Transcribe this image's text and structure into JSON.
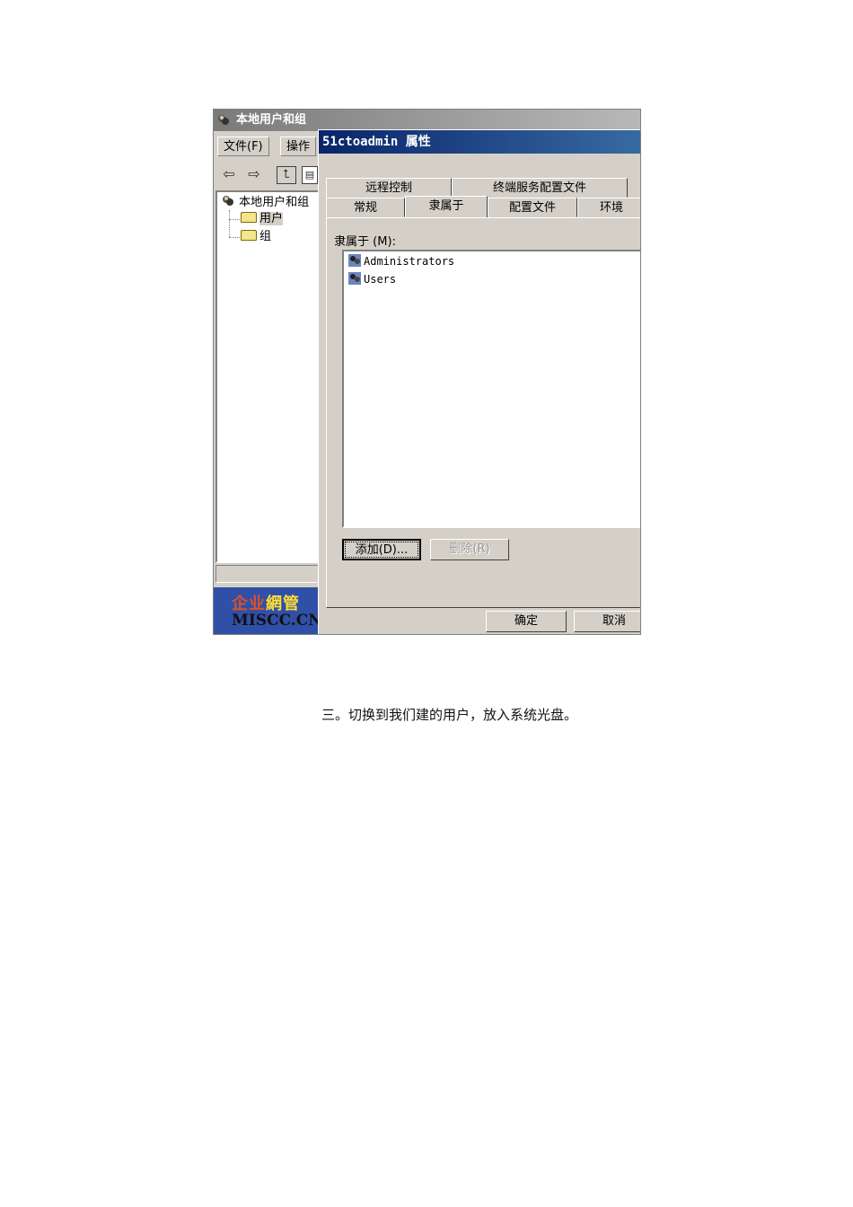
{
  "mmc": {
    "title": "本地用户和组",
    "menu": [
      "文件(F)",
      "操作"
    ],
    "toolbar_icons": [
      "back-arrow-icon",
      "forward-arrow-icon",
      "up-folder-icon",
      "console-tree-icon"
    ],
    "tree": {
      "root": "本地用户和组",
      "children": [
        {
          "label": "用户",
          "selected": true
        },
        {
          "label": "组",
          "selected": false
        }
      ]
    }
  },
  "logo": {
    "cn_part1": "企业",
    "cn_part2": "網管",
    "en": "MISCC.CN"
  },
  "dialog": {
    "title": "51ctoadmin 属性",
    "tabs_row1": [
      "远程控制",
      "终端服务配置文件"
    ],
    "tabs_row2": [
      "常规",
      "隶属于",
      "配置文件",
      "环境"
    ],
    "active_tab": "隶属于",
    "list_label": "隶属于",
    "list_label_key": "(M):",
    "groups": [
      "Administrators",
      "Users"
    ],
    "add_button": "添加(D)...",
    "remove_button": "删除(R)",
    "ok_button": "确定",
    "cancel_button": "取消"
  },
  "caption": "三。切换到我们建的用户，放入系统光盘。"
}
